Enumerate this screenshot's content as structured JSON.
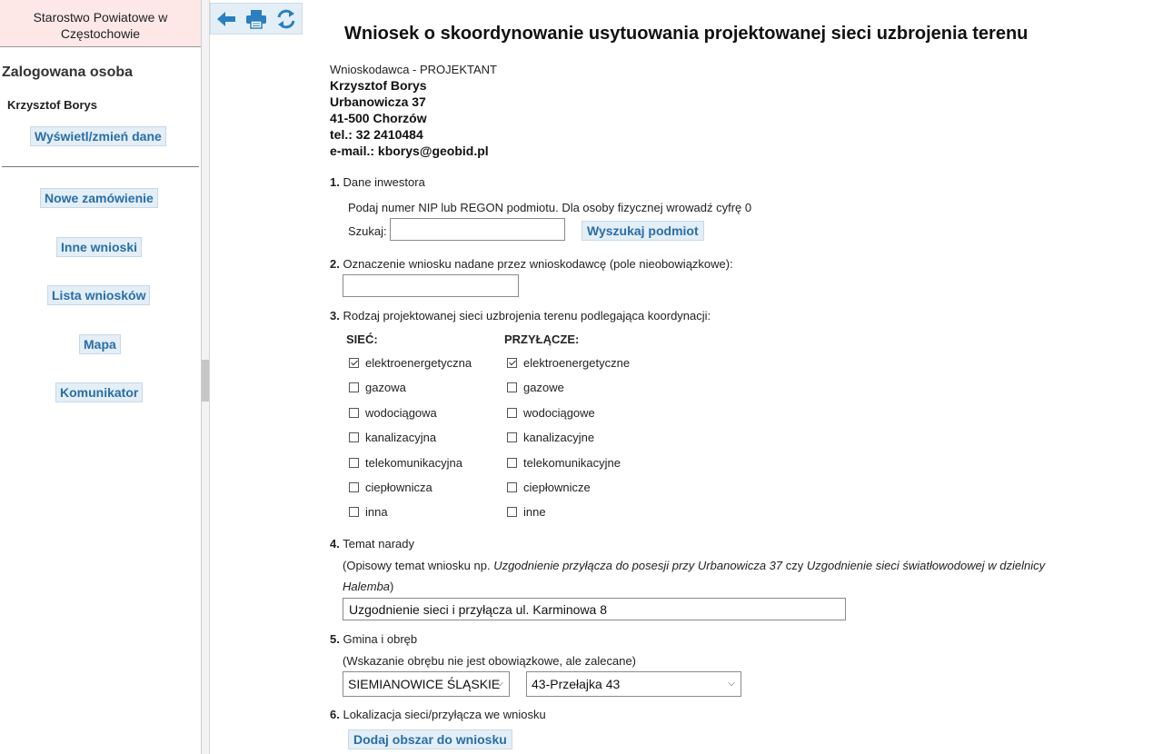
{
  "sidebar": {
    "office_line1": "Starostwo Powiatowe w",
    "office_line2": "Częstochowie",
    "logged_title": "Zalogowana osoba",
    "user_name": "Krzysztof Borys",
    "edit_button": "Wyświetl/zmień dane",
    "nav": [
      "Nowe zamówienie",
      "Inne wnioski",
      "Lista wniosków",
      "Mapa",
      "Komunikator"
    ]
  },
  "toolbar": {
    "icons": [
      "back-arrow-icon",
      "print-icon",
      "refresh-icon"
    ],
    "accent": "#2a7fbf"
  },
  "form": {
    "title": "Wniosek o skoordynowanie usytuowania projektowanej sieci uzbrojenia terenu",
    "applicant": {
      "role": "Wnioskodawca - PROJEKTANT",
      "name": "Krzysztof Borys",
      "street": "Urbanowicza 37",
      "city": "41-500 Chorzów",
      "phone": "tel.: 32 2410484",
      "email": "e-mail.: kborys@geobid.pl"
    },
    "s1": {
      "num": "1.",
      "label": "Dane inwestora",
      "hint": "Podaj numer NIP lub REGON podmiotu. Dla osoby fizycznej wrowadź cyfrę 0",
      "search_label": "Szukaj:",
      "search_value": "",
      "search_button": "Wyszukaj podmiot"
    },
    "s2": {
      "num": "2.",
      "label": "Oznaczenie wniosku nadane przez wnioskodawcę (pole nieobowiązkowe):",
      "value": ""
    },
    "s3": {
      "num": "3.",
      "label": "Rodzaj projektowanej sieci uzbrojenia terenu podlegająca koordynacji:",
      "net_header": "SIEĆ:",
      "conn_header": "PRZYŁĄCZE:",
      "net": [
        {
          "label": "elektroenergetyczna",
          "checked": true
        },
        {
          "label": "gazowa",
          "checked": false
        },
        {
          "label": "wodociągowa",
          "checked": false
        },
        {
          "label": "kanalizacyjna",
          "checked": false
        },
        {
          "label": "telekomunikacyjna",
          "checked": false
        },
        {
          "label": "ciepłownicza",
          "checked": false
        },
        {
          "label": "inna",
          "checked": false
        }
      ],
      "conn": [
        {
          "label": "elektroenergetyczne",
          "checked": true
        },
        {
          "label": "gazowe",
          "checked": false
        },
        {
          "label": "wodociągowe",
          "checked": false
        },
        {
          "label": "kanalizacyjne",
          "checked": false
        },
        {
          "label": "telekomunikacyjne",
          "checked": false
        },
        {
          "label": "ciepłownicze",
          "checked": false
        },
        {
          "label": "inne",
          "checked": false
        }
      ]
    },
    "s4": {
      "num": "4.",
      "label": "Temat narady",
      "hint_prefix": "(Opisowy temat wniosku np. ",
      "hint_ex1": "Uzgodnienie przyłącza do posesji przy Urbanowicza 37",
      "hint_mid": " czy ",
      "hint_ex2": "Uzgodnienie sieci światłowodowej w dzielnicy",
      "hint_ex3": "Halemba",
      "hint_suffix": ")",
      "value": "Uzgodnienie sieci i przyłącza ul. Karminowa 8"
    },
    "s5": {
      "num": "5.",
      "label": "Gmina i obręb",
      "hint": "(Wskazanie obrębu nie jest obowiązkowe, ale zalecane)",
      "gmina": "SIEMIANOWICE ŚLĄSKIE",
      "obreb": "43-Przełajka 43"
    },
    "s6": {
      "num": "6.",
      "label": "Lokalizacja sieci/przyłącza we wniosku",
      "button": "Dodaj obszar do wniosku"
    }
  }
}
